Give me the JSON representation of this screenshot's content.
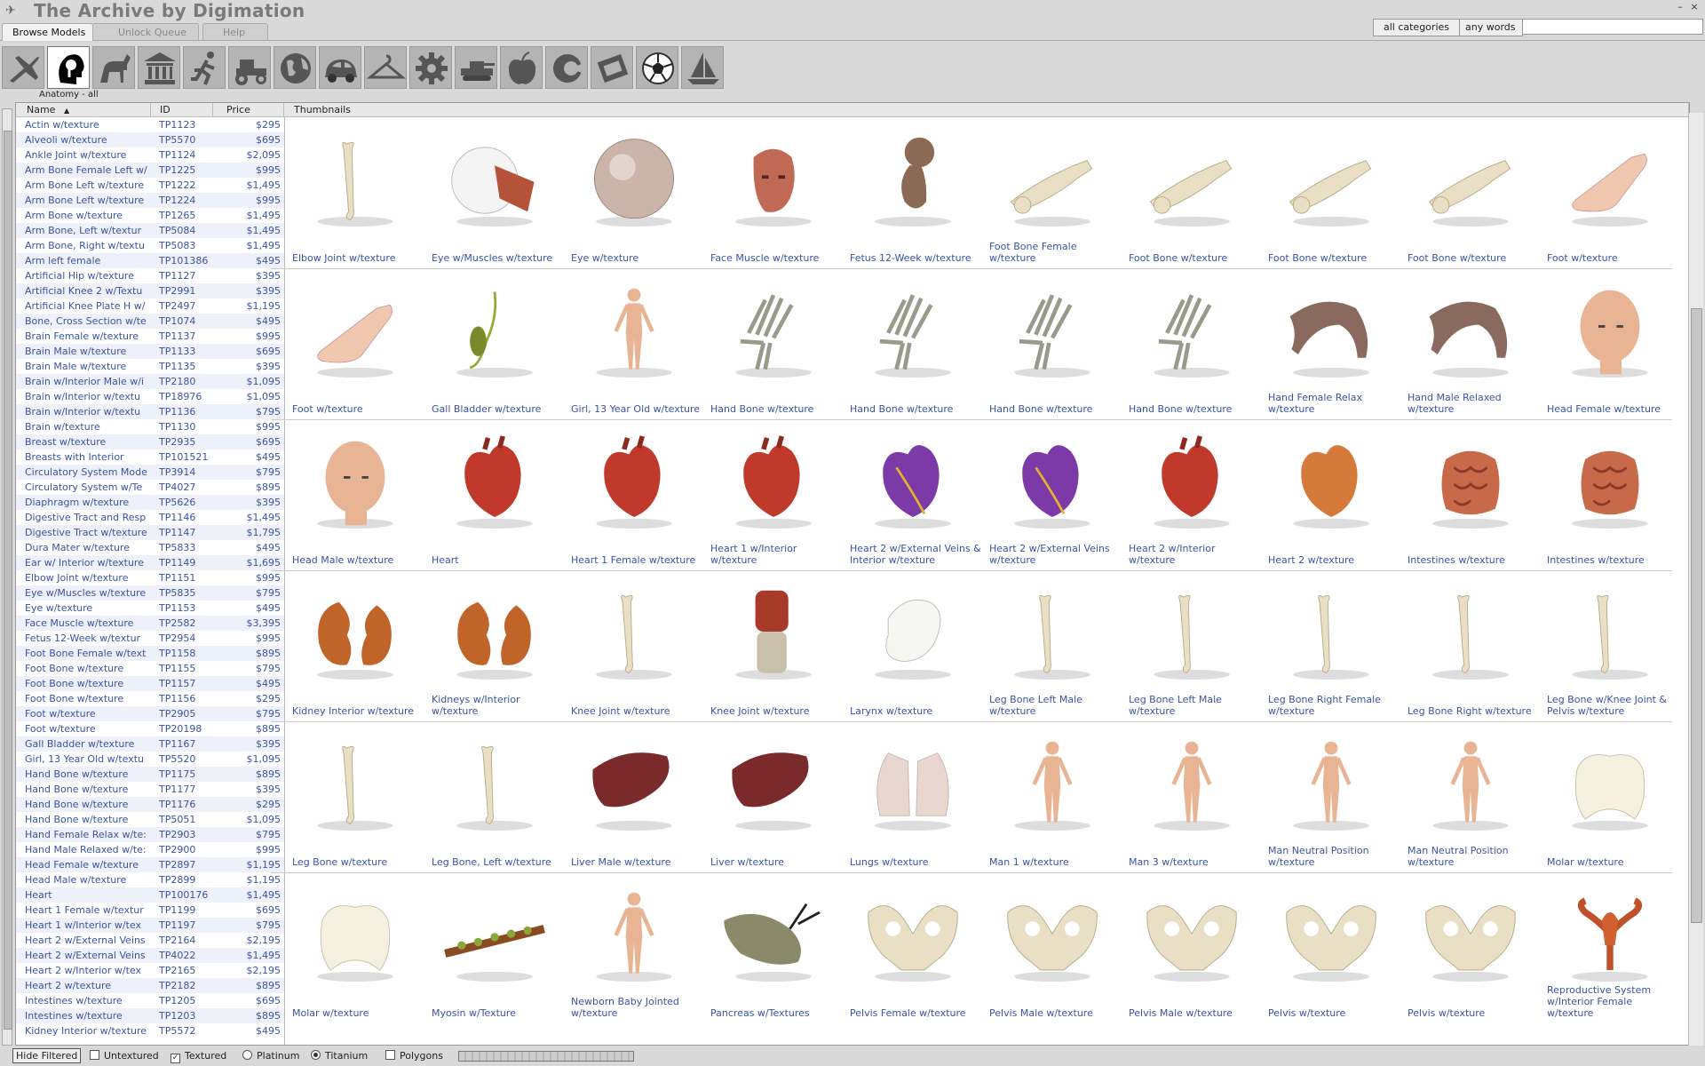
{
  "app": {
    "title": "The Archive by Digimation"
  },
  "window_controls": {
    "minimize": "–",
    "close": "×"
  },
  "search": {
    "category": "all categories",
    "mode": "any words",
    "query": ""
  },
  "tabs": [
    "Browse Models",
    "Unlock Queue",
    "Help"
  ],
  "categories": [
    {
      "icon": "airplane-icon"
    },
    {
      "icon": "anatomy-head-icon",
      "active": true
    },
    {
      "icon": "horse-icon"
    },
    {
      "icon": "building-icon"
    },
    {
      "icon": "runner-icon"
    },
    {
      "icon": "tractor-icon"
    },
    {
      "icon": "globe-icon"
    },
    {
      "icon": "car-icon"
    },
    {
      "icon": "hanger-icon"
    },
    {
      "icon": "gear-icon"
    },
    {
      "icon": "tank-icon"
    },
    {
      "icon": "apple-icon"
    },
    {
      "icon": "abstract-icon"
    },
    {
      "icon": "film-icon"
    },
    {
      "icon": "soccer-ball-icon"
    },
    {
      "icon": "sailboat-icon"
    }
  ],
  "category_label": "Anatomy - all",
  "columns": {
    "name": "Name",
    "id": "ID",
    "price": "Price",
    "thumbnails": "Thumbnails"
  },
  "list": [
    {
      "name": "Actin w/texture",
      "id": "TP1123",
      "price": "$295"
    },
    {
      "name": "Alveoli w/texture",
      "id": "TP5570",
      "price": "$695"
    },
    {
      "name": "Ankle Joint w/texture",
      "id": "TP1124",
      "price": "$2,095"
    },
    {
      "name": "Arm Bone Female Left w/",
      "id": "TP1225",
      "price": "$995"
    },
    {
      "name": "Arm Bone Left w/texture",
      "id": "TP1222",
      "price": "$1,495"
    },
    {
      "name": "Arm Bone Left w/texture",
      "id": "TP1224",
      "price": "$995"
    },
    {
      "name": "Arm Bone w/texture",
      "id": "TP1265",
      "price": "$1,495"
    },
    {
      "name": "Arm Bone, Left w/textur",
      "id": "TP5084",
      "price": "$1,495"
    },
    {
      "name": "Arm Bone, Right w/textu",
      "id": "TP5083",
      "price": "$1,495"
    },
    {
      "name": "Arm left female",
      "id": "TP101386",
      "price": "$495"
    },
    {
      "name": "Artificial Hip w/texture",
      "id": "TP1127",
      "price": "$395"
    },
    {
      "name": "Artificial Knee 2 w/Textu",
      "id": "TP2991",
      "price": "$395"
    },
    {
      "name": "Artificial Knee Plate H w/",
      "id": "TP2497",
      "price": "$1,195"
    },
    {
      "name": "Bone, Cross Section w/te",
      "id": "TP1074",
      "price": "$495"
    },
    {
      "name": "Brain Female w/texture",
      "id": "TP1137",
      "price": "$995"
    },
    {
      "name": "Brain Male w/texture",
      "id": "TP1133",
      "price": "$695"
    },
    {
      "name": "Brain Male w/texture",
      "id": "TP1135",
      "price": "$395"
    },
    {
      "name": "Brain w/Interior Male w/i",
      "id": "TP2180",
      "price": "$1,095"
    },
    {
      "name": "Brain w/Interior w/textu",
      "id": "TP18976",
      "price": "$1,095"
    },
    {
      "name": "Brain w/Interior w/textu",
      "id": "TP1136",
      "price": "$795"
    },
    {
      "name": "Brain w/texture",
      "id": "TP1130",
      "price": "$995"
    },
    {
      "name": "Breast w/texture",
      "id": "TP2935",
      "price": "$695"
    },
    {
      "name": "Breasts with Interior",
      "id": "TP101521",
      "price": "$495"
    },
    {
      "name": "Circulatory System Mode",
      "id": "TP3914",
      "price": "$795"
    },
    {
      "name": "Circulatory System w/Te",
      "id": "TP4027",
      "price": "$895"
    },
    {
      "name": "Diaphragm w/texture",
      "id": "TP5626",
      "price": "$395"
    },
    {
      "name": "Digestive Tract and Resp",
      "id": "TP1146",
      "price": "$1,495"
    },
    {
      "name": "Digestive Tract w/texture",
      "id": "TP1147",
      "price": "$1,795"
    },
    {
      "name": "Dura Mater w/texture",
      "id": "TP5833",
      "price": "$495"
    },
    {
      "name": "Ear w/ Interior w/texture",
      "id": "TP1149",
      "price": "$1,695"
    },
    {
      "name": "Elbow Joint w/texture",
      "id": "TP1151",
      "price": "$995"
    },
    {
      "name": "Eye w/Muscles w/texture",
      "id": "TP5835",
      "price": "$795"
    },
    {
      "name": "Eye w/texture",
      "id": "TP1153",
      "price": "$495"
    },
    {
      "name": "Face Muscle w/texture",
      "id": "TP2582",
      "price": "$3,395"
    },
    {
      "name": "Fetus 12-Week w/textur",
      "id": "TP2954",
      "price": "$995"
    },
    {
      "name": "Foot Bone Female w/text",
      "id": "TP1158",
      "price": "$895"
    },
    {
      "name": "Foot Bone w/texture",
      "id": "TP1155",
      "price": "$795"
    },
    {
      "name": "Foot Bone w/texture",
      "id": "TP1157",
      "price": "$495"
    },
    {
      "name": "Foot Bone w/texture",
      "id": "TP1156",
      "price": "$295"
    },
    {
      "name": "Foot w/texture",
      "id": "TP2905",
      "price": "$795"
    },
    {
      "name": "Foot w/texture",
      "id": "TP20198",
      "price": "$895"
    },
    {
      "name": "Gall Bladder w/texture",
      "id": "TP1167",
      "price": "$395"
    },
    {
      "name": "Girl, 13 Year Old w/textu",
      "id": "TP5520",
      "price": "$1,095"
    },
    {
      "name": "Hand Bone w/texture",
      "id": "TP1175",
      "price": "$895"
    },
    {
      "name": "Hand Bone w/texture",
      "id": "TP1177",
      "price": "$395"
    },
    {
      "name": "Hand Bone w/texture",
      "id": "TP1176",
      "price": "$295"
    },
    {
      "name": "Hand Bone w/texture",
      "id": "TP5051",
      "price": "$1,095"
    },
    {
      "name": "Hand Female Relax w/te:",
      "id": "TP2903",
      "price": "$795"
    },
    {
      "name": "Hand Male Relaxed w/te:",
      "id": "TP2900",
      "price": "$995"
    },
    {
      "name": "Head Female w/texture",
      "id": "TP2897",
      "price": "$1,195"
    },
    {
      "name": "Head Male w/texture",
      "id": "TP2899",
      "price": "$1,195"
    },
    {
      "name": "Heart",
      "id": "TP100176",
      "price": "$1,495"
    },
    {
      "name": "Heart 1 Female w/textur",
      "id": "TP1199",
      "price": "$695"
    },
    {
      "name": "Heart 1 w/Interior w/tex",
      "id": "TP1197",
      "price": "$795"
    },
    {
      "name": "Heart 2 w/External Veins",
      "id": "TP2164",
      "price": "$2,195"
    },
    {
      "name": "Heart 2 w/External Veins",
      "id": "TP4022",
      "price": "$1,495"
    },
    {
      "name": "Heart 2 w/Interior w/tex",
      "id": "TP2165",
      "price": "$2,195"
    },
    {
      "name": "Heart 2 w/texture",
      "id": "TP2182",
      "price": "$895"
    },
    {
      "name": "Intestines w/texture",
      "id": "TP1205",
      "price": "$695"
    },
    {
      "name": "Intestines w/texture",
      "id": "TP1203",
      "price": "$895"
    },
    {
      "name": "Kidney Interior w/texture",
      "id": "TP5572",
      "price": "$495"
    }
  ],
  "thumbnails": [
    [
      "Elbow Joint w/texture",
      "Eye w/Muscles w/texture",
      "Eye w/texture",
      "Face Muscle w/texture",
      "Fetus 12-Week w/texture",
      "Foot Bone Female w/texture",
      "Foot Bone w/texture",
      "Foot Bone w/texture",
      "Foot Bone w/texture",
      "Foot w/texture"
    ],
    [
      "Foot w/texture",
      "Gall Bladder w/texture",
      "Girl, 13 Year Old w/texture",
      "Hand Bone w/texture",
      "Hand Bone w/texture",
      "Hand Bone w/texture",
      "Hand Bone w/texture",
      "Hand Female Relax w/texture",
      "Hand Male Relaxed w/texture",
      "Head Female w/texture"
    ],
    [
      "Head Male w/texture",
      "Heart",
      "Heart 1 Female w/texture",
      "Heart 1 w/Interior w/texture",
      "Heart 2 w/External Veins & Interior w/texture",
      "Heart 2 w/External Veins w/texture",
      "Heart 2 w/Interior w/texture",
      "Heart 2 w/texture",
      "Intestines w/texture",
      "Intestines w/texture"
    ],
    [
      "Kidney Interior w/texture",
      "Kidneys w/Interior w/texture",
      "Knee Joint w/texture",
      "Knee Joint w/texture",
      "Larynx w/texture",
      "Leg Bone Left Male w/texture",
      "Leg Bone Left Male w/texture",
      "Leg Bone Right Female w/texture",
      "Leg Bone Right w/texture",
      "Leg Bone w/Knee Joint & Pelvis w/texture"
    ],
    [
      "Leg Bone w/texture",
      "Leg Bone, Left w/texture",
      "Liver Male w/texture",
      "Liver w/texture",
      "Lungs w/texture",
      "Man 1 w/texture",
      "Man 3 w/texture",
      "Man Neutral Position w/texture",
      "Man Neutral Position w/texture",
      "Molar w/texture"
    ],
    [
      "Molar w/texture",
      "Myosin w/Texture",
      "Newborn Baby Jointed w/texture",
      "Pancreas w/Textures",
      "Pelvis Female w/texture",
      "Pelvis Male w/texture",
      "Pelvis Male w/texture",
      "Pelvis w/texture",
      "Pelvis w/texture",
      "Reproductive System w/Interior Female w/texture"
    ]
  ],
  "thumb_kinds": [
    [
      "bone",
      "eye",
      "sphere",
      "head-red",
      "fetus",
      "footbone",
      "footbone",
      "footbone",
      "footbone",
      "foot"
    ],
    [
      "foot",
      "gall",
      "figure",
      "handbone",
      "handbone",
      "handbone",
      "handbone",
      "hand",
      "hand",
      "head"
    ],
    [
      "head",
      "heart",
      "heart",
      "heart",
      "heart-purple",
      "heart-purple",
      "heart",
      "heart-orange",
      "intestine",
      "intestine"
    ],
    [
      "kidney",
      "kidney",
      "bone",
      "knee",
      "larynx",
      "bone",
      "bone",
      "bone",
      "bone",
      "bone"
    ],
    [
      "bone",
      "bone",
      "liver",
      "liver",
      "lungs",
      "figure",
      "figure",
      "figure",
      "figure",
      "molar"
    ],
    [
      "molar",
      "myosin",
      "figure",
      "pancreas",
      "pelvis",
      "pelvis",
      "pelvis",
      "pelvis",
      "pelvis",
      "reproductive"
    ]
  ],
  "colors": {
    "skin": "#e8b494",
    "bone": "#e8dfc4",
    "heart": "#c0392b",
    "organ": "#b5533a",
    "link": "#3a54a4"
  },
  "status": {
    "hide_filtered": "Hide Filtered",
    "untextured": "Untextured",
    "untextured_checked": false,
    "textured": "Textured",
    "textured_checked": true,
    "platinum": "Platinum",
    "platinum_selected": false,
    "titanium": "Titanium",
    "titanium_selected": true,
    "polygons": "Polygons",
    "polygons_checked": false
  }
}
